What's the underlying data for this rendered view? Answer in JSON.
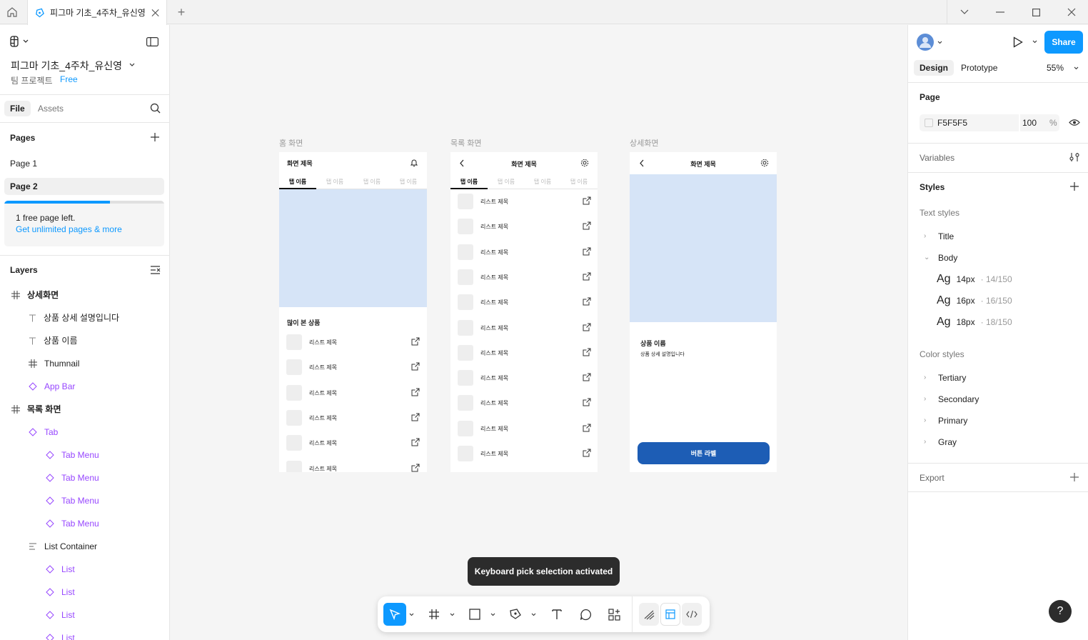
{
  "titlebar": {
    "tab_title": "피그마 기초_4주차_유신영",
    "home_icon": "home-icon",
    "new_tab": "+"
  },
  "left": {
    "file_name": "피그마 기초_4주차_유신영",
    "team": "팀 프로젝트",
    "plan": "Free",
    "tabs": {
      "file": "File",
      "assets": "Assets"
    },
    "pages_header": "Pages",
    "pages": [
      "Page 1",
      "Page 2"
    ],
    "upgrade": {
      "line1": "1 free page left.",
      "line2": "Get unlimited pages & more",
      "progress": 0.66
    },
    "layers_header": "Layers",
    "layers": [
      {
        "label": "상세화면",
        "icon": "frame-icon",
        "indent": 0,
        "bold": true
      },
      {
        "label": "상품 상세 설명입니다",
        "icon": "text-icon",
        "indent": 1
      },
      {
        "label": "상품 이름",
        "icon": "text-icon",
        "indent": 1
      },
      {
        "label": "Thumnail",
        "icon": "frame-icon",
        "indent": 1
      },
      {
        "label": "App Bar",
        "icon": "component-icon",
        "indent": 1,
        "purple": true
      },
      {
        "label": "목록 화면",
        "icon": "frame-icon",
        "indent": 0,
        "bold": true
      },
      {
        "label": "Tab",
        "icon": "component-icon",
        "indent": 1,
        "purple": true
      },
      {
        "label": "Tab Menu",
        "icon": "component-icon",
        "indent": 2,
        "purple": true
      },
      {
        "label": "Tab Menu",
        "icon": "component-icon",
        "indent": 2,
        "purple": true
      },
      {
        "label": "Tab Menu",
        "icon": "component-icon",
        "indent": 2,
        "purple": true
      },
      {
        "label": "Tab Menu",
        "icon": "component-icon",
        "indent": 2,
        "purple": true
      },
      {
        "label": "List Container",
        "icon": "autolayout-icon",
        "indent": 1
      },
      {
        "label": "List",
        "icon": "component-icon",
        "indent": 2,
        "purple": true
      },
      {
        "label": "List",
        "icon": "component-icon",
        "indent": 2,
        "purple": true
      },
      {
        "label": "List",
        "icon": "component-icon",
        "indent": 2,
        "purple": true
      },
      {
        "label": "List",
        "icon": "component-icon",
        "indent": 2,
        "purple": true
      }
    ]
  },
  "canvas": {
    "frames": {
      "home": {
        "label": "홈 화면",
        "title": "화면 제목",
        "tabs": [
          "탭 이름",
          "탭 이름",
          "탭 이름",
          "탭 이름"
        ],
        "section": "많이 본 상품",
        "items": [
          "리스트 제목",
          "리스트 제목",
          "리스트 제목",
          "리스트 제목",
          "리스트 제목",
          "리스트 제목"
        ]
      },
      "list": {
        "label": "목록 화면",
        "title": "화면 제목",
        "tabs": [
          "탭 이름",
          "탭 이름",
          "탭 이름",
          "탭 이름"
        ],
        "items": [
          "리스트 제목",
          "리스트 제목",
          "리스트 제목",
          "리스트 제목",
          "리스트 제목",
          "리스트 제목",
          "리스트 제목",
          "리스트 제목",
          "리스트 제목",
          "리스트 제목",
          "리스트 제목"
        ]
      },
      "detail": {
        "label": "상세화면",
        "title": "화면 제목",
        "product_name": "상품 이름",
        "product_desc": "상품 상세 설명입니다",
        "button": "버튼 라벨"
      }
    },
    "toast": "Keyboard pick selection activated"
  },
  "right": {
    "share": "Share",
    "tabs": {
      "design": "Design",
      "prototype": "Prototype"
    },
    "zoom": "55%",
    "page_header": "Page",
    "page_color": "F5F5F5",
    "page_opacity": "100",
    "percent": "%",
    "variables": "Variables",
    "styles": "Styles",
    "text_styles": "Text styles",
    "text_groups": [
      "Title",
      "Body"
    ],
    "body_styles": [
      {
        "ag": "Ag",
        "size": "14px",
        "sub": "· 14/150"
      },
      {
        "ag": "Ag",
        "size": "16px",
        "sub": "· 16/150"
      },
      {
        "ag": "Ag",
        "size": "18px",
        "sub": "· 18/150"
      }
    ],
    "color_styles": "Color styles",
    "color_groups": [
      "Tertiary",
      "Secondary",
      "Primary",
      "Gray"
    ],
    "export": "Export",
    "help": "?"
  },
  "colors": {
    "accent": "#0d99ff",
    "component": "#9747ff",
    "hero": "#d6e4f7",
    "cta": "#1d5db5",
    "canvas": "#f5f5f5"
  }
}
